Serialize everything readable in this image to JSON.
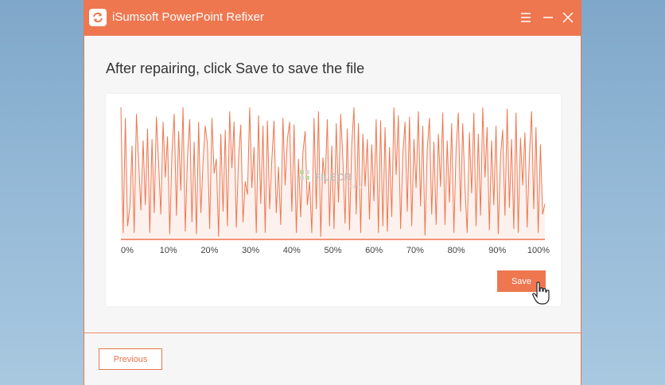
{
  "window": {
    "title": "iSumsoft PowerPoint Refixer",
    "icons": {
      "logo": "refresh-arrows-icon",
      "menu": "hamburger-menu-icon",
      "minimize": "minimize-icon",
      "close": "close-icon"
    }
  },
  "main": {
    "heading": "After repairing, click Save to save the file",
    "watermark": {
      "brand": "FILECR",
      "suffix": ".com"
    }
  },
  "chart_data": {
    "type": "line",
    "xlim": [
      0,
      100
    ],
    "ylim": [
      0,
      100
    ],
    "x_tick_labels": [
      "0%",
      "10%",
      "20%",
      "30%",
      "40%",
      "50%",
      "60%",
      "70%",
      "80%",
      "90%",
      "100%"
    ],
    "grid": false,
    "color": "#ee7750",
    "values": [
      100,
      5,
      92,
      10,
      25,
      71,
      5,
      95,
      59,
      22,
      75,
      26,
      84,
      5,
      76,
      20,
      93,
      58,
      19,
      89,
      47,
      78,
      4,
      66,
      95,
      18,
      82,
      37,
      100,
      6,
      63,
      91,
      13,
      74,
      4,
      89,
      20,
      59,
      86,
      72,
      8,
      92,
      50,
      61,
      2,
      80,
      21,
      83,
      10,
      97,
      54,
      89,
      9,
      62,
      87,
      13,
      44,
      34,
      100,
      39,
      70,
      5,
      94,
      27,
      86,
      5,
      90,
      23,
      61,
      90,
      20,
      55,
      11,
      92,
      41,
      76,
      89,
      21,
      87,
      5,
      61,
      17,
      66,
      82,
      26,
      44,
      5,
      92,
      23,
      97,
      2,
      62,
      42,
      91,
      10,
      71,
      8,
      88,
      28,
      95,
      60,
      12,
      84,
      7,
      72,
      100,
      19,
      88,
      5,
      80,
      40,
      76,
      15,
      72,
      29,
      91,
      5,
      90,
      10,
      85,
      6,
      70,
      17,
      100,
      49,
      94,
      8,
      64,
      89,
      21,
      93,
      10,
      76,
      39,
      97,
      25,
      86,
      3,
      68,
      92,
      19,
      74,
      11,
      80,
      40,
      96,
      11,
      75,
      28,
      88,
      5,
      69,
      96,
      21,
      88,
      40,
      5,
      81,
      35,
      96,
      10,
      80,
      18,
      100,
      47,
      85,
      7,
      75,
      26,
      86,
      4,
      63,
      83,
      18,
      99,
      24,
      76,
      8,
      96,
      5,
      77,
      41,
      81,
      9,
      63,
      97,
      23,
      85,
      5,
      72,
      19,
      27
    ]
  },
  "buttons": {
    "save": "Save",
    "previous": "Previous"
  },
  "colors": {
    "accent": "#ee7750",
    "border": "#e8774e"
  }
}
